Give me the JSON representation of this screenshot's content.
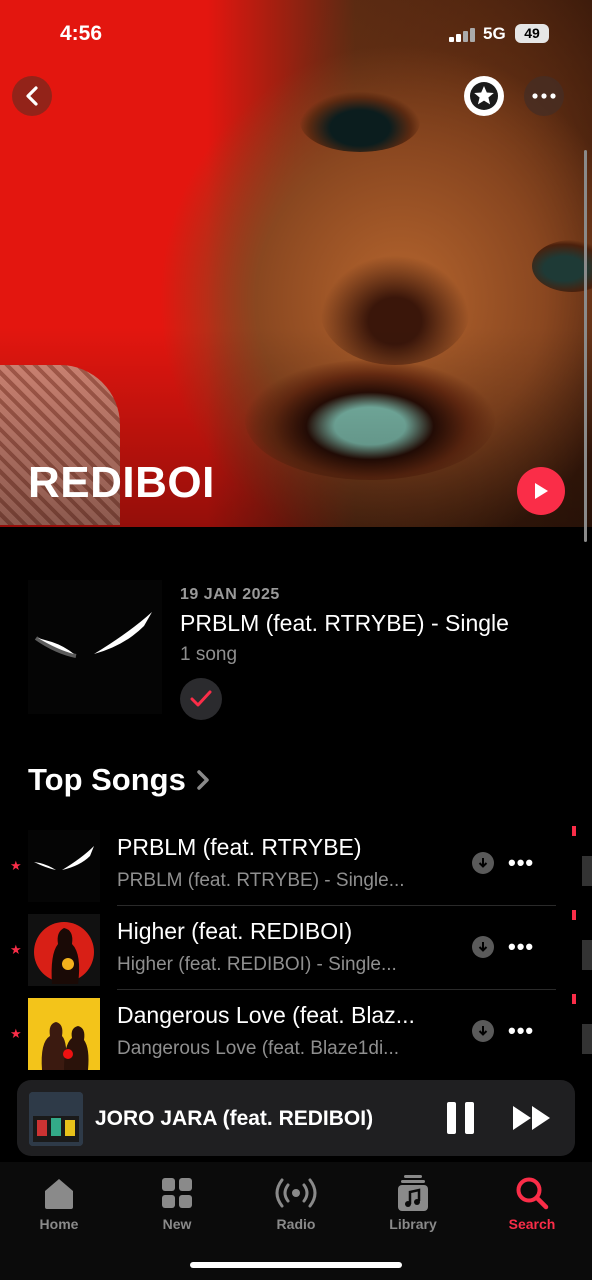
{
  "status_bar": {
    "time": "4:56",
    "network": "5G",
    "battery": "49"
  },
  "artist": {
    "name": "REDIBOI"
  },
  "latest_release": {
    "date": "19 JAN 2025",
    "title": "PRBLM (feat. RTRYBE) - Single",
    "count": "1 song"
  },
  "top_songs": {
    "title": "Top Songs",
    "items": [
      {
        "title": "PRBLM (feat. RTRYBE)",
        "subtitle": "PRBLM (feat. RTRYBE) - Single..."
      },
      {
        "title": "Higher (feat. REDIBOI)",
        "subtitle": "Higher (feat. REDIBOI) - Single..."
      },
      {
        "title": "Dangerous Love (feat. Blaz...",
        "subtitle": "Dangerous Love (feat. Blaze1di..."
      }
    ]
  },
  "now_playing": {
    "title": "JORO JARA (feat. REDIBOI)"
  },
  "tabs": [
    {
      "label": "Home",
      "icon": "home-icon"
    },
    {
      "label": "New",
      "icon": "grid-icon"
    },
    {
      "label": "Radio",
      "icon": "radio-icon"
    },
    {
      "label": "Library",
      "icon": "library-icon"
    },
    {
      "label": "Search",
      "icon": "search-icon"
    }
  ],
  "colors": {
    "accent": "#fa2d48",
    "background": "#000000",
    "secondary_text": "#8f8f8f"
  }
}
